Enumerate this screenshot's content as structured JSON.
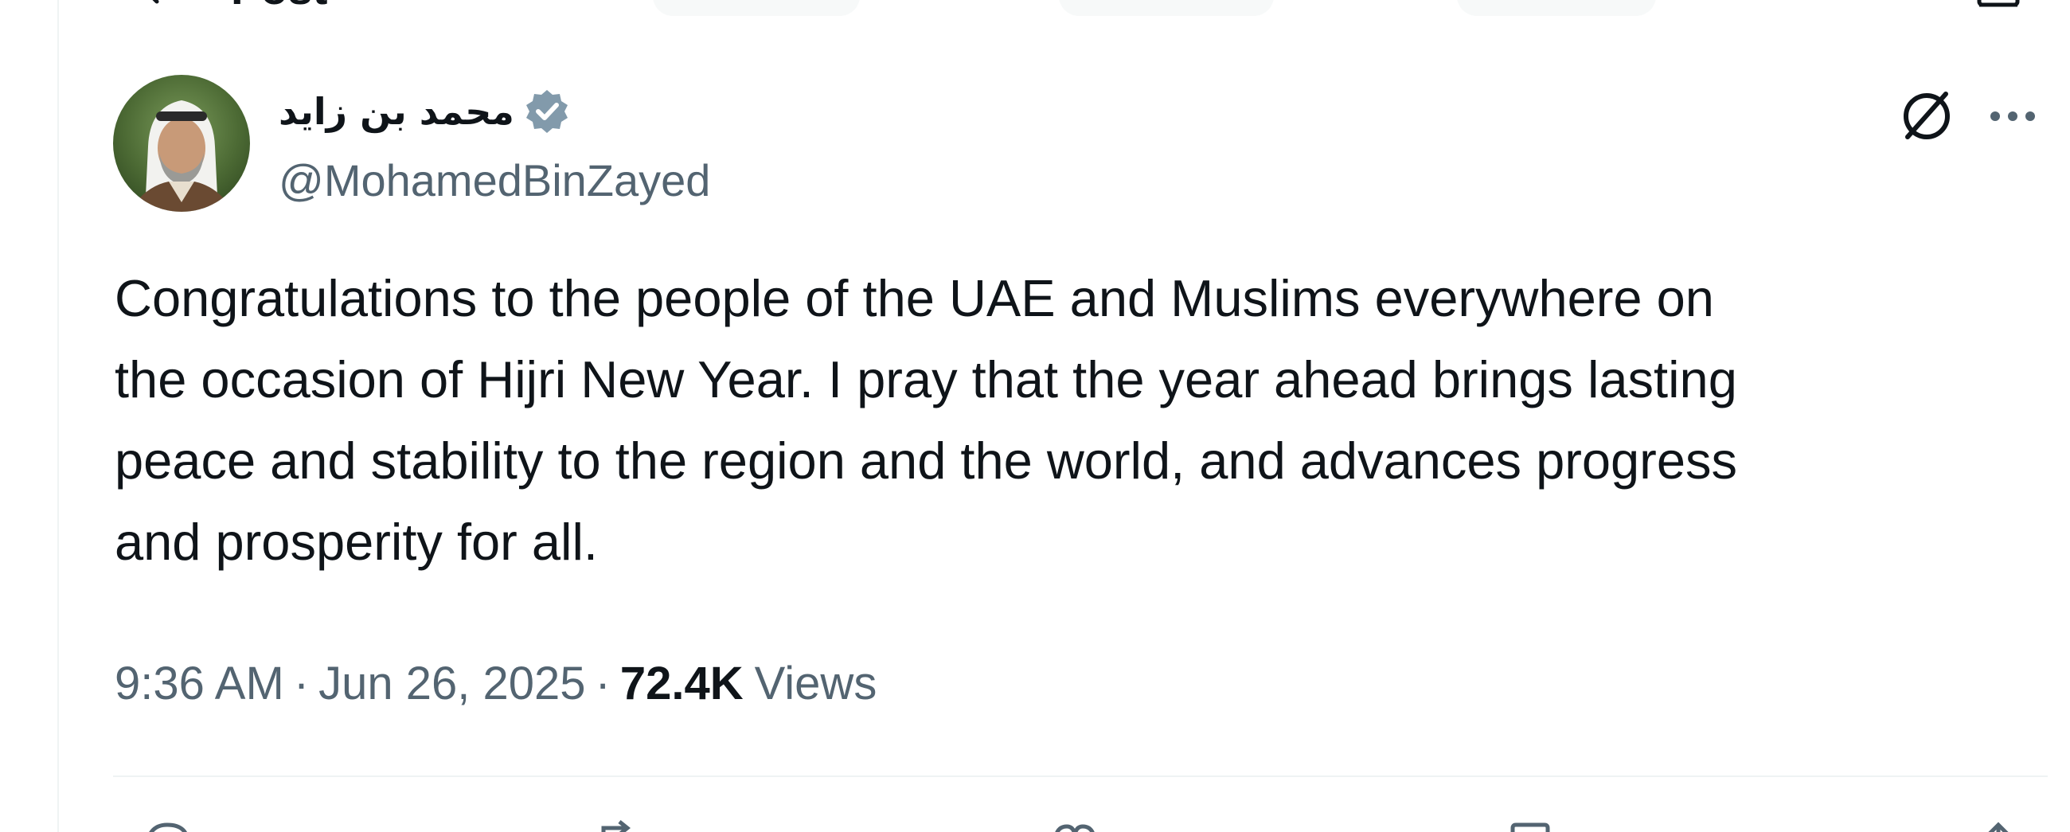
{
  "header": {
    "title": "Post"
  },
  "author": {
    "display_name": "محمد بن زايد",
    "handle": "@MohamedBinZayed",
    "verified": true,
    "badge_color": "#829aab"
  },
  "post": {
    "text": "Congratulations to the people of the UAE and Muslims everywhere on\nthe occasion of Hijri New Year. I pray that the year ahead brings lasting\npeace and stability to the region and the world, and advances progress\nand prosperity for all.",
    "time": "9:36 AM",
    "date": "Jun 26, 2025",
    "separator": "·",
    "views_count": "72.4K",
    "views_label": "Views"
  },
  "icons": {
    "back": "back-arrow-icon",
    "grok": "grok-icon",
    "more": "more-icon",
    "verified": "verified-badge-icon",
    "reply": "reply-icon",
    "repost": "repost-icon",
    "like": "like-icon",
    "bookmark": "bookmark-icon",
    "share": "share-icon"
  },
  "colors": {
    "text_primary": "#0f1419",
    "text_secondary": "#536471",
    "divider": "#eff3f4",
    "badge": "#829aab"
  }
}
